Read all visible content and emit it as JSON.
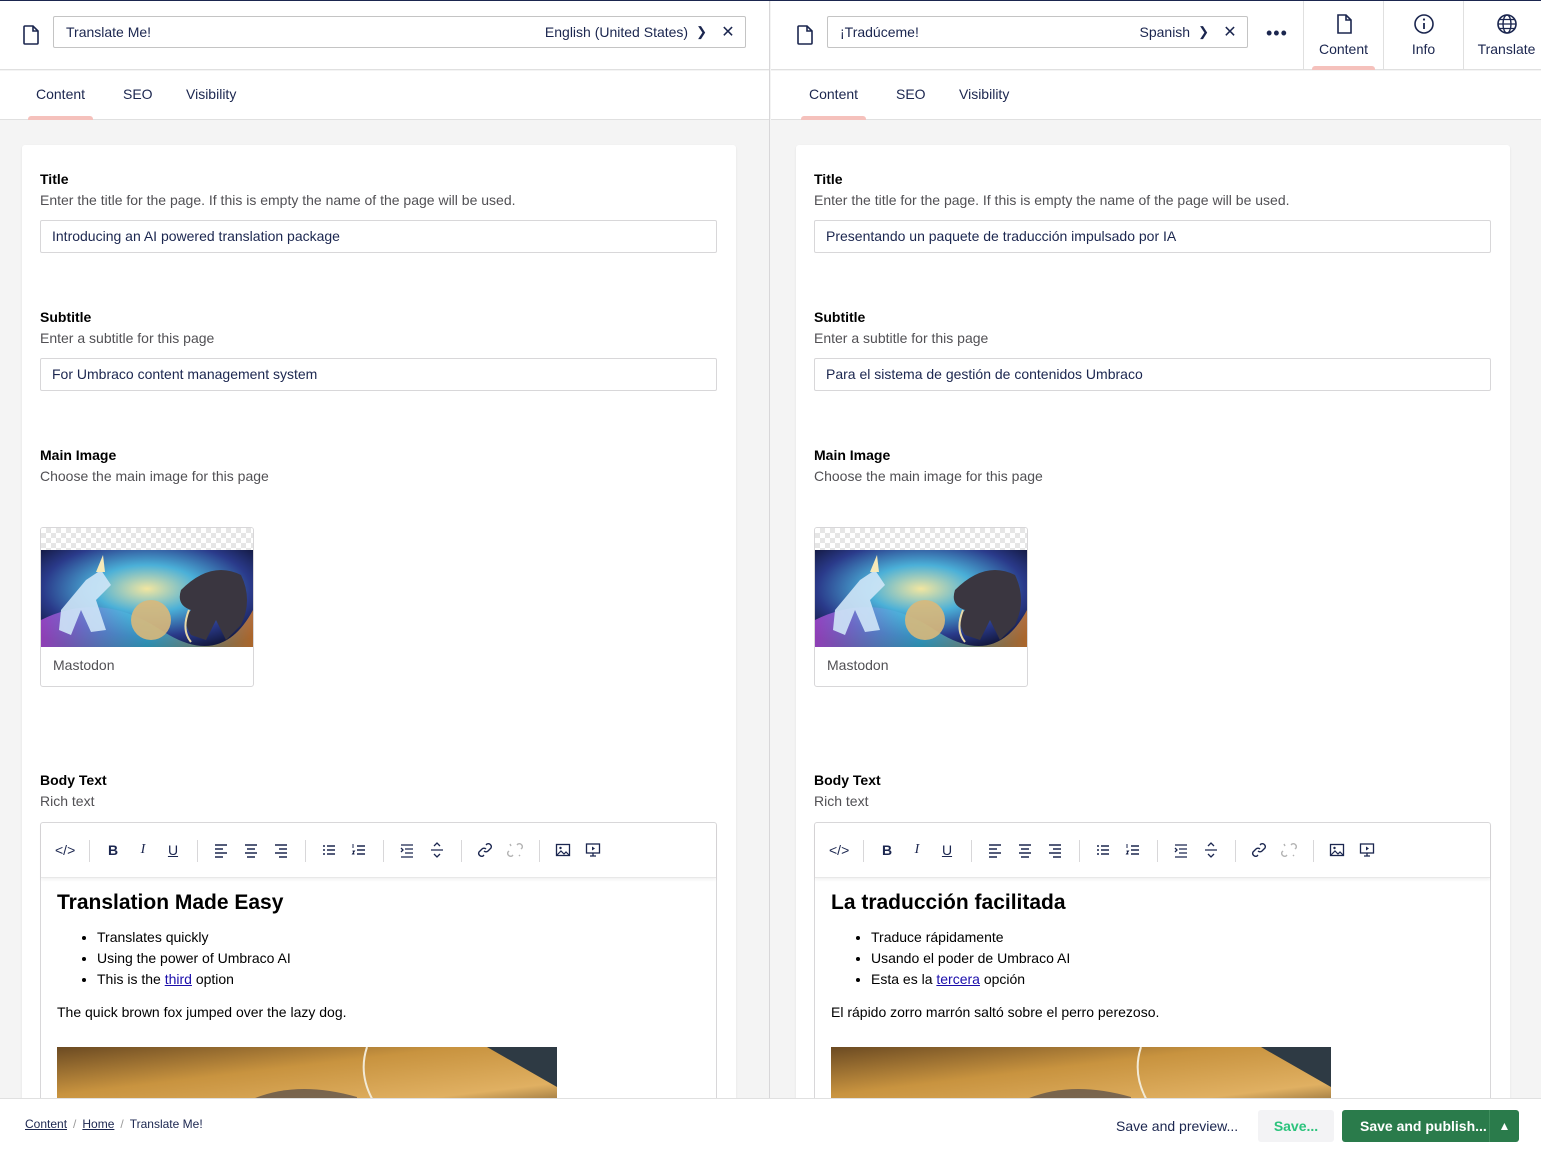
{
  "left": {
    "name": "Translate Me!",
    "language": "English (United States)",
    "tabs": [
      "Content",
      "SEO",
      "Visibility"
    ],
    "title_label": "Title",
    "title_desc": "Enter the title for the page. If this is empty the name of the page will be used.",
    "title_value": "Introducing an AI powered translation package",
    "subtitle_label": "Subtitle",
    "subtitle_desc": "Enter a subtitle for this page",
    "subtitle_value": "For Umbraco content management system",
    "image_label": "Main Image",
    "image_desc": "Choose the main image for this page",
    "image_name": "Mastodon",
    "body_label": "Body Text",
    "body_desc": "Rich text",
    "body_heading": "Translation Made Easy",
    "bullets": [
      "Translates quickly",
      "Using the power of Umbraco AI"
    ],
    "bullet3_pre": "This is the ",
    "bullet3_link": "third",
    "bullet3_post": " option",
    "paragraph": "The quick brown fox jumped over the lazy dog."
  },
  "right": {
    "name": "¡Tradúceme!",
    "language": "Spanish",
    "tabs": [
      "Content",
      "SEO",
      "Visibility"
    ],
    "title_label": "Title",
    "title_desc": "Enter the title for the page. If this is empty the name of the page will be used.",
    "title_value": "Presentando un paquete de traducción impulsado por IA",
    "subtitle_label": "Subtitle",
    "subtitle_desc": "Enter a subtitle for this page",
    "subtitle_value": "Para el sistema de gestión de contenidos Umbraco",
    "image_label": "Main Image",
    "image_desc": "Choose the main image for this page",
    "image_name": "Mastodon",
    "body_label": "Body Text",
    "body_desc": "Rich text",
    "body_heading": "La traducción facilitada",
    "bullets": [
      "Traduce rápidamente",
      "Usando el poder de Umbraco AI"
    ],
    "bullet3_pre": "Esta es la ",
    "bullet3_link": "tercera",
    "bullet3_post": " opción",
    "paragraph": "El rápido zorro marrón saltó sobre el perro perezoso."
  },
  "apps": {
    "content": "Content",
    "info": "Info",
    "translate": "Translate"
  },
  "footer": {
    "breadcrumb": [
      "Content",
      "Home",
      "Translate Me!"
    ],
    "save_preview": "Save and preview...",
    "save": "Save...",
    "save_publish": "Save and publish..."
  },
  "colors": {
    "primary_text": "#1b264f",
    "tab_indicator": "#f5c1bc",
    "publish_button": "#2a7b4b",
    "save_text": "#2bc37c",
    "link": "#1a0dab"
  }
}
